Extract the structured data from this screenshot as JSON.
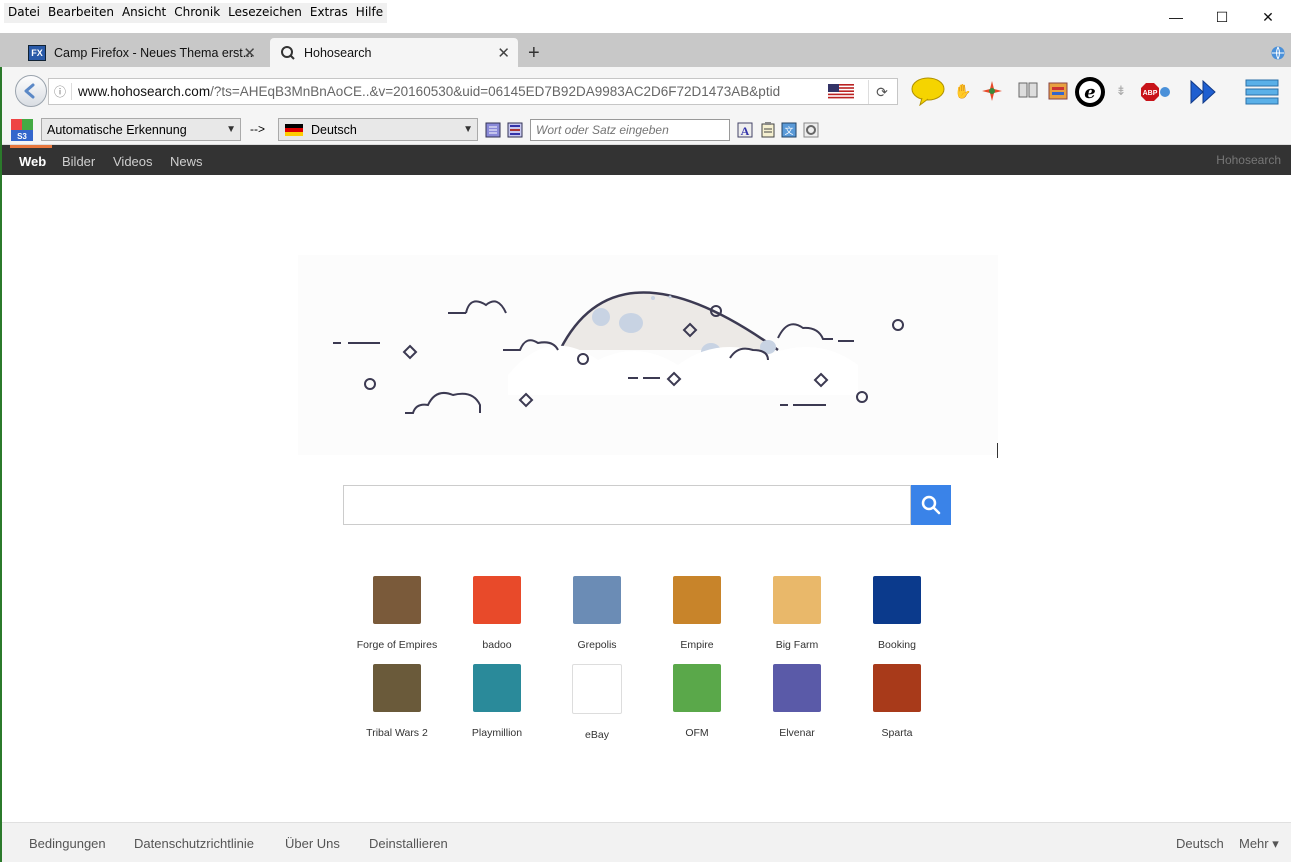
{
  "menu": [
    "Datei",
    "Bearbeiten",
    "Ansicht",
    "Chronik",
    "Lesezeichen",
    "Extras",
    "Hilfe"
  ],
  "window": {
    "minimize": "—",
    "maximize": "☐",
    "close": "✕"
  },
  "tabs": [
    {
      "title": "Camp Firefox - Neues Thema erst...",
      "favicon": "FX"
    },
    {
      "title": "Hohosearch"
    }
  ],
  "newtab": "+",
  "url": {
    "host": "www.hohosearch.com",
    "rest": "/?ts=AHEqB3MnBnAoCE..&v=20160530&uid=06145ED7B92DA9983AC2D6F72D1473AB&ptid"
  },
  "translate": {
    "source": "Automatische Erkennung",
    "arrow": "-->",
    "target": "Deutsch",
    "placeholder": "Wort oder Satz eingeben"
  },
  "sitenav": {
    "items": [
      "Web",
      "Bilder",
      "Videos",
      "News"
    ],
    "brand": "Hohosearch"
  },
  "search": {
    "placeholder": ""
  },
  "tiles": [
    {
      "label": "Forge of Empires",
      "color": "#7a5a3a"
    },
    {
      "label": "badoo",
      "color": "#e84a2a"
    },
    {
      "label": "Grepolis",
      "color": "#6b8cb5"
    },
    {
      "label": "Empire",
      "color": "#c8842a"
    },
    {
      "label": "Big Farm",
      "color": "#e9b86a"
    },
    {
      "label": "Booking",
      "color": "#0b3a8c"
    },
    {
      "label": "Tribal Wars 2",
      "color": "#6a5a3a"
    },
    {
      "label": "Playmillion",
      "color": "#2a8a9a"
    },
    {
      "label": "eBay",
      "color": "#ffffff"
    },
    {
      "label": "OFM",
      "color": "#5aa84a"
    },
    {
      "label": "Elvenar",
      "color": "#5a5aa8"
    },
    {
      "label": "Sparta",
      "color": "#a83a1a"
    }
  ],
  "footer": {
    "links": [
      "Bedingungen",
      "Datenschutzrichtlinie",
      "Über Uns",
      "Deinstallieren"
    ],
    "lang": "Deutsch",
    "more": "Mehr ▾"
  }
}
